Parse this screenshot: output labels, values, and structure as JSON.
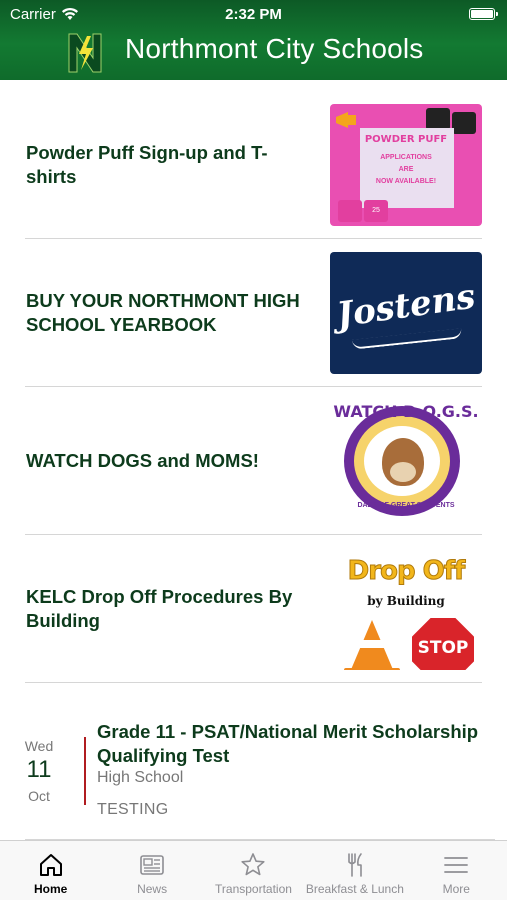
{
  "status_bar": {
    "carrier": "Carrier",
    "time": "2:32 PM"
  },
  "header": {
    "title": "Northmont City Schools",
    "logo_letter": "N",
    "brand_color": "#137a32"
  },
  "news": [
    {
      "title": "Powder Puff Sign-up and T-shirts",
      "thumb": {
        "headline": "POWDER PUFF",
        "lines": [
          "APPLICATIONS",
          "ARE",
          "NOW AVAILABLE!"
        ],
        "shirt_number": "25"
      }
    },
    {
      "title": "BUY YOUR NORTHMONT HIGH SCHOOL YEARBOOK",
      "thumb": {
        "brand": "Jostens"
      }
    },
    {
      "title": "WATCH DOGS and MOMS!",
      "thumb": {
        "top": "WATCH D.O.G.S.",
        "bottom": "DADS OF GREAT STUDENTS"
      }
    },
    {
      "title": "KELC Drop Off Procedures By Building",
      "thumb": {
        "headline": "Drop Off",
        "sub": "by Building",
        "sign": "STOP"
      }
    }
  ],
  "event": {
    "weekday": "Wed",
    "day": "11",
    "month": "Oct",
    "title": "Grade 11 - PSAT/National Merit Scholarship Qualifying Test",
    "location": "High School",
    "category": "TESTING",
    "accent_color": "#b01c20"
  },
  "tabbar": {
    "active": "Home",
    "tabs": [
      {
        "label": "Home",
        "icon": "home-icon"
      },
      {
        "label": "News",
        "icon": "newspaper-icon"
      },
      {
        "label": "Transportation",
        "icon": "star-icon"
      },
      {
        "label": "Breakfast & Lunch",
        "icon": "fork-knife-icon"
      },
      {
        "label": "More",
        "icon": "menu-icon"
      }
    ]
  }
}
